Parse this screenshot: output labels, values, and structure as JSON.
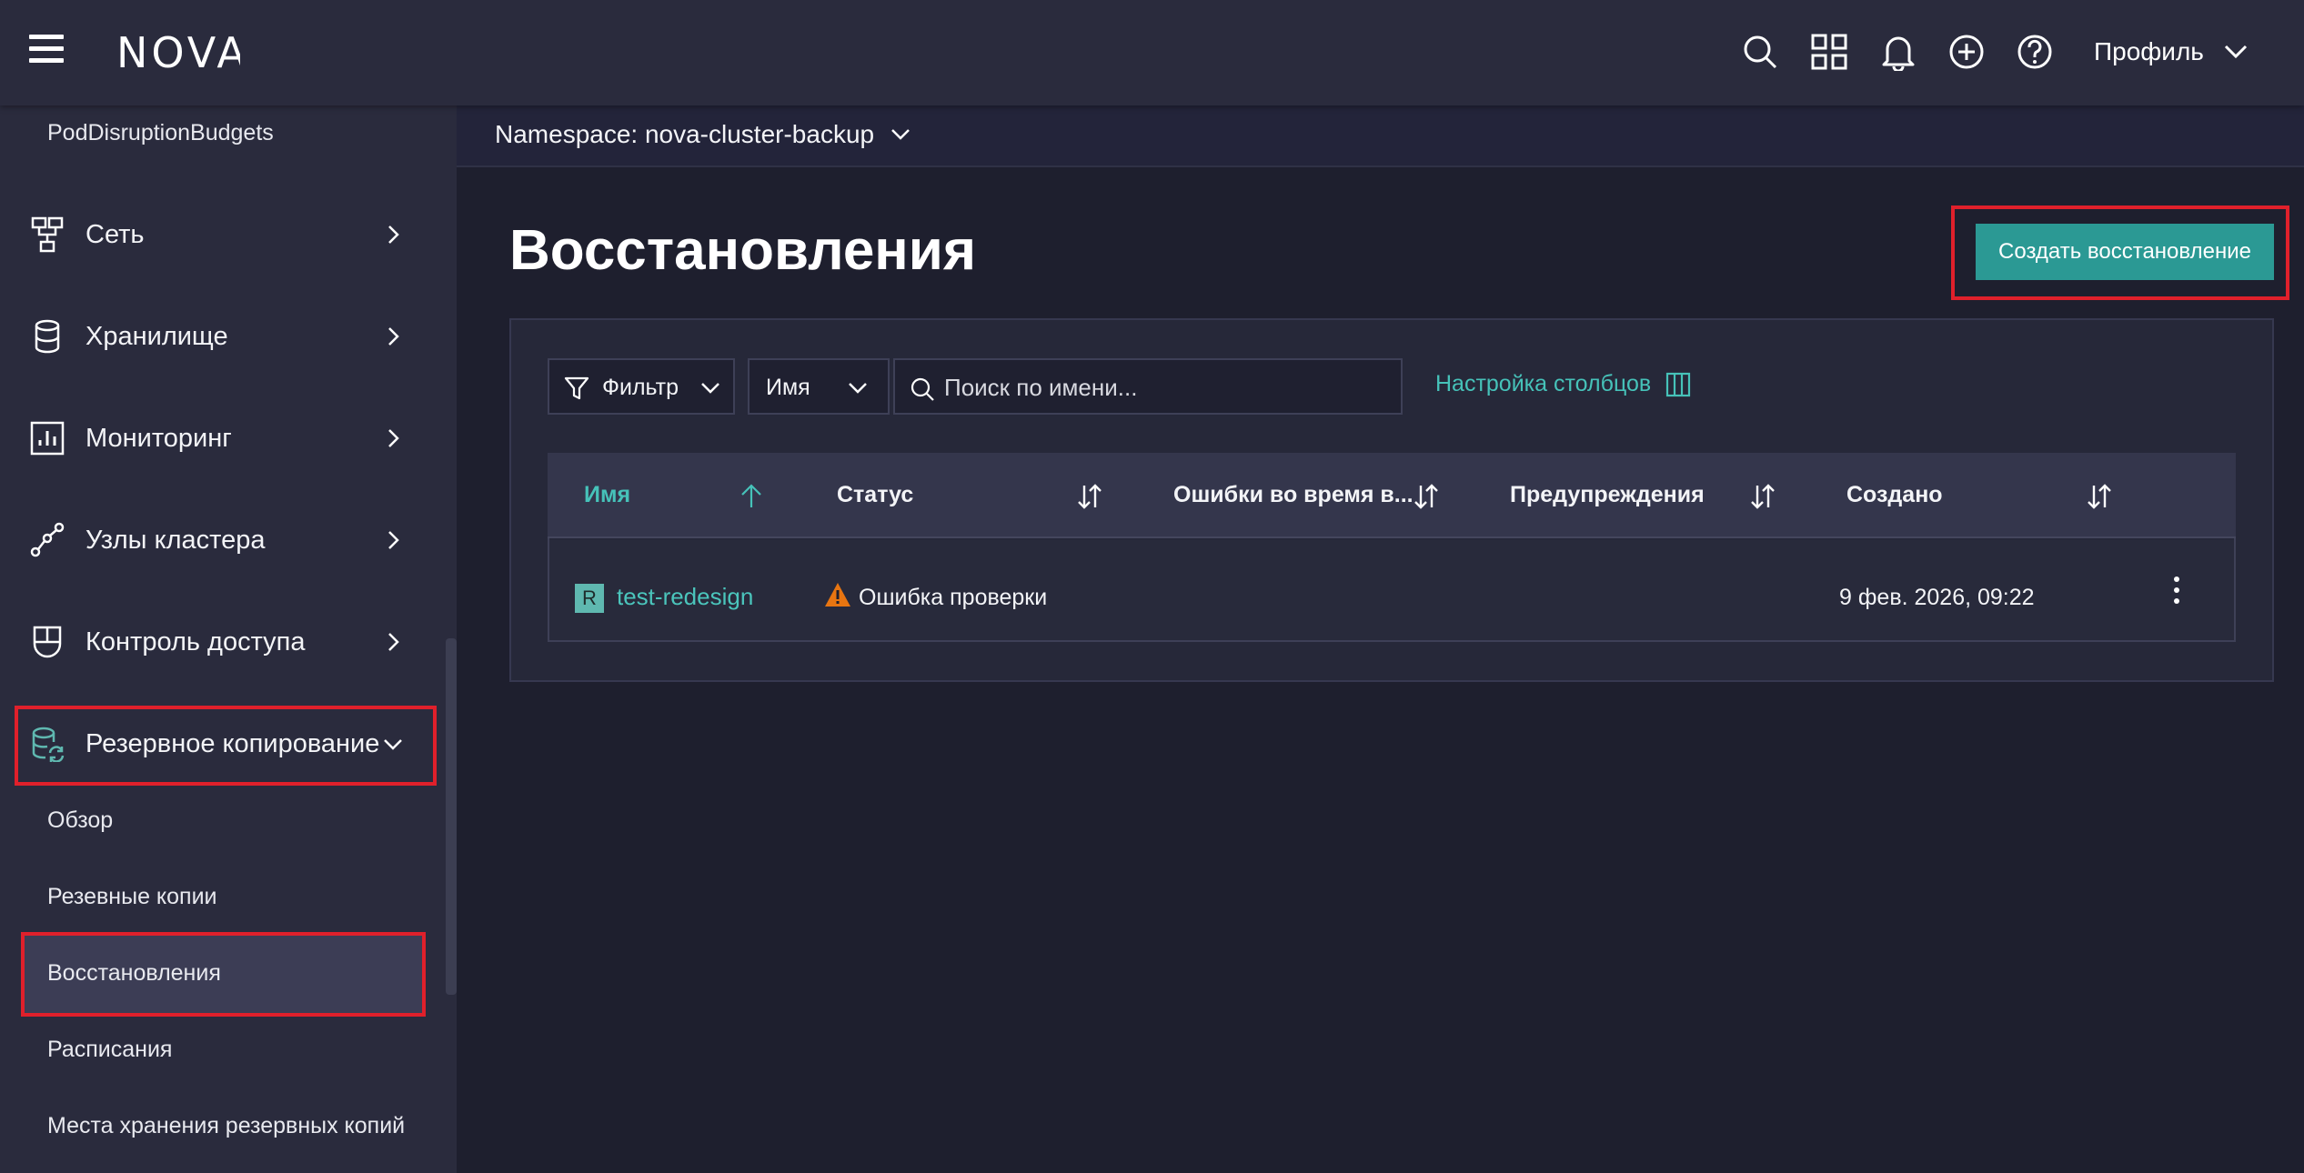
{
  "header": {
    "logo_text": "NOVA",
    "profile_label": "Профиль"
  },
  "sidebar": {
    "top_link": "PodDisruptionBudgets",
    "items": [
      {
        "label": "Сеть",
        "icon": "network-icon"
      },
      {
        "label": "Хранилище",
        "icon": "database-icon"
      },
      {
        "label": "Мониторинг",
        "icon": "chart-icon"
      },
      {
        "label": "Узлы кластера",
        "icon": "nodes-icon"
      },
      {
        "label": "Контроль доступа",
        "icon": "shield-icon"
      },
      {
        "label": "Резервное копирование",
        "icon": "backup-icon",
        "expanded": true
      }
    ],
    "sub_items": [
      {
        "label": "Обзор"
      },
      {
        "label": "Резевные копии"
      },
      {
        "label": "Восстановления",
        "active": true
      },
      {
        "label": "Расписания"
      },
      {
        "label": "Места хранения резервных копий"
      }
    ]
  },
  "namespace": {
    "label": "Namespace: nova-cluster-backup"
  },
  "main": {
    "title": "Восстановления",
    "create_button": "Создать восстановление",
    "toolbar": {
      "filter_label": "Фильтр",
      "field_select": "Имя",
      "search_placeholder": "Поиск по имени...",
      "columns_label": "Настройка столбцов"
    },
    "table": {
      "columns": [
        "Имя",
        "Статус",
        "Ошибки во время в...",
        "Предупреждения",
        "Создано"
      ],
      "rows": [
        {
          "badge": "R",
          "name": "test-redesign",
          "status": "Ошибка проверки",
          "errors": "",
          "warnings": "",
          "created": "9 фев. 2026, 09:22"
        }
      ]
    }
  },
  "colors": {
    "accent": "#2b9994",
    "link": "#4bc5bc",
    "highlight": "#e0202b",
    "warning": "#e87511"
  }
}
